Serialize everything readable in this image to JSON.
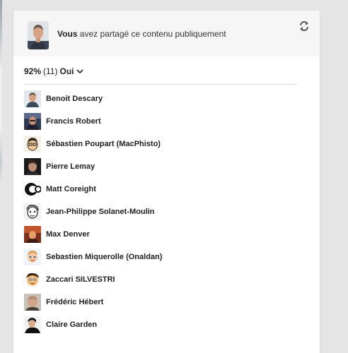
{
  "header": {
    "actor": "Vous",
    "message": "avez partagé ce contenu publiquement",
    "reshare_icon": "reshare-icon"
  },
  "vote": {
    "percent": "92%",
    "count": "(11)",
    "answer": "Oui",
    "dropdown_icon": "chevron-down-icon"
  },
  "voters": [
    {
      "name": "Benoit Descary"
    },
    {
      "name": "Francis Robert"
    },
    {
      "name": "Sébastien Poupart (MacPhisto)"
    },
    {
      "name": "Pierre Lemay"
    },
    {
      "name": "Matt Coreight"
    },
    {
      "name": "Jean-Philippe Solanet-Moulin"
    },
    {
      "name": "Max Denver"
    },
    {
      "name": "Sebastien Miquerolle (Onaldan)"
    },
    {
      "name": "Zaccari SILVESTRI"
    },
    {
      "name": "Frédéric Hébert"
    },
    {
      "name": "Claire Garden"
    }
  ]
}
